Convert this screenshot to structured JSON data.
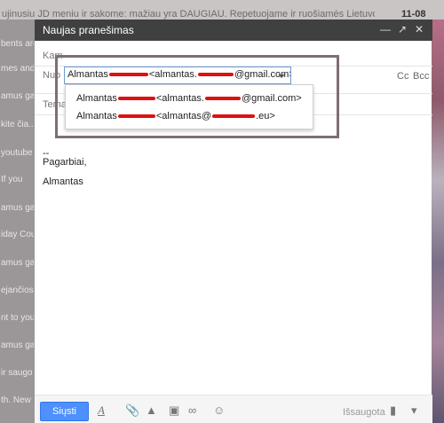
{
  "background": {
    "subject_line": "ujinusiu JD meniu ir sakome: mažiau yra DAUGIAU. Repetuojame ir ruošiamės Lietuvos gin",
    "date": "11-08",
    "rows": [
      "bents are",
      "mes and",
      "amus gau",
      "kite čia...",
      "youtube",
      "If you",
      "amus gau",
      "iday Cou",
      "amus gau",
      "ejančios",
      "nt to you",
      "amus gau",
      "ir saugo",
      "th. New"
    ]
  },
  "compose": {
    "title": "Naujas pranešimas",
    "to_label": "Kam",
    "from_label": "Nuo",
    "subject_label": "Tema",
    "cc_label": "Cc",
    "bcc_label": "Bcc",
    "from_selected": {
      "name": "Almantas",
      "email_part": "<almantas.",
      "email_domain": "@gmail.com>"
    },
    "from_options": [
      {
        "name": "Almantas",
        "email_part": "<almantas.",
        "email_domain": "@gmail.com>"
      },
      {
        "name": "Almantas",
        "email_part": "<almantas@",
        "email_domain": ".eu>"
      }
    ],
    "body": {
      "sig_sep": "--",
      "line1": "Pagarbiai,",
      "line2": "Almantas"
    },
    "send_label": "Siųsti",
    "saved_label": "Išsaugota"
  },
  "icons": {
    "minimize": "minimize-icon",
    "expand": "expand-icon",
    "close": "close-icon",
    "formatting": "formatting-icon",
    "attach": "paperclip-icon",
    "drive": "drive-icon",
    "photo": "photo-icon",
    "link": "link-icon",
    "emoji": "emoji-icon",
    "trash": "trash-icon",
    "more": "more-options-icon"
  },
  "colors": {
    "titlebar": "#404040",
    "send_button": "#4d90fe",
    "redaction": "#e01010"
  }
}
